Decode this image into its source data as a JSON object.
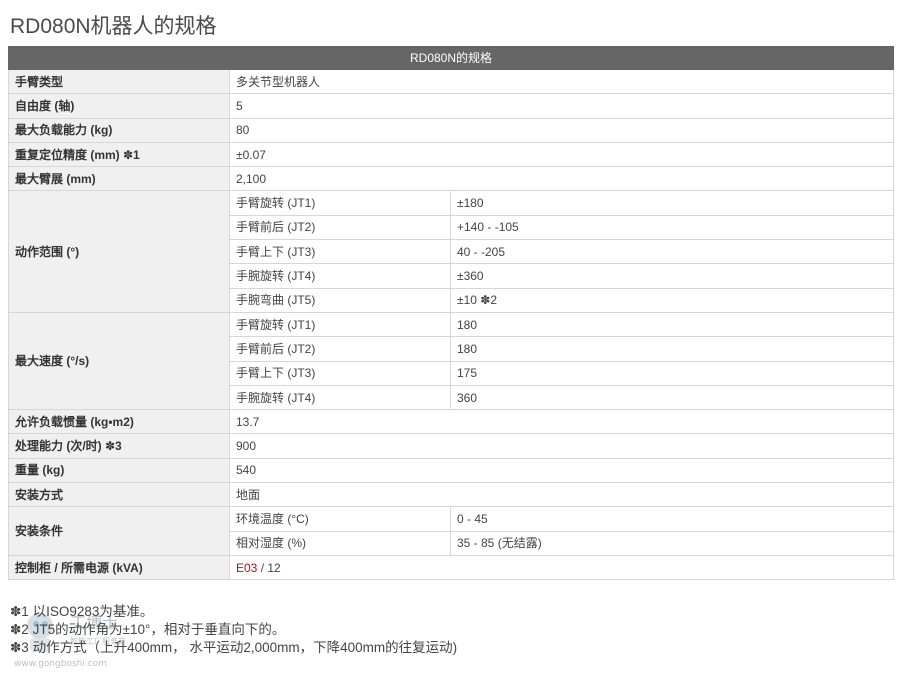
{
  "page_title": "RD080N机器人的规格",
  "table": {
    "header": "RD080N的规格",
    "rows": {
      "arm_type": {
        "label": "手臂类型",
        "value": "多关节型机器人"
      },
      "dof": {
        "label": "自由度 (轴)",
        "value": "5"
      },
      "payload": {
        "label": "最大负载能力 (kg)",
        "value": "80"
      },
      "repeatability": {
        "label": "重复定位精度 (mm) ✽1",
        "value": "±0.07"
      },
      "reach": {
        "label": "最大臂展 (mm)",
        "value": "2,100"
      },
      "motion_range": {
        "label": "动作范围 (°)",
        "items": [
          {
            "name": "手臂旋转 (JT1)",
            "value": "±180"
          },
          {
            "name": "手臂前后 (JT2)",
            "value": "+140 - -105"
          },
          {
            "name": "手臂上下 (JT3)",
            "value": "40 - -205"
          },
          {
            "name": "手腕旋转 (JT4)",
            "value": "±360"
          },
          {
            "name": "手腕弯曲 (JT5)",
            "value": "±10 ✽2"
          }
        ]
      },
      "max_speed": {
        "label": "最大速度 (°/s)",
        "items": [
          {
            "name": "手臂旋转 (JT1)",
            "value": "180"
          },
          {
            "name": "手臂前后 (JT2)",
            "value": "180"
          },
          {
            "name": "手臂上下 (JT3)",
            "value": "175"
          },
          {
            "name": "手腕旋转 (JT4)",
            "value": "360"
          }
        ]
      },
      "inertia": {
        "label": "允许负载惯量 (kg•m2)",
        "value": "13.7"
      },
      "throughput": {
        "label": "处理能力 (次/时) ✽3",
        "value": "900"
      },
      "weight": {
        "label": "重量 (kg)",
        "value": "540"
      },
      "mounting": {
        "label": "安装方式",
        "value": "地面"
      },
      "install_cond": {
        "label": "安装条件",
        "items": [
          {
            "name": "环境温度 (°C)",
            "value": "0 - 45"
          },
          {
            "name": "相对湿度 (%)",
            "value": "35 - 85 (无结露)"
          }
        ]
      },
      "controller": {
        "label": "控制柜 / 所需电源 (kVA)",
        "link": "E03",
        "suffix": " / 12"
      }
    }
  },
  "notes": [
    "✽1 以ISO9283为基准。",
    "✽2 JT5的动作角为±10°，相对于垂直向下的。",
    "✽3 动作方式（上升400mm， 水平运动2,000mm，下降400mm的往复运动)"
  ],
  "watermark": {
    "brand": "工博士",
    "sub": "智能工厂服务商",
    "url": "www.gongboshi.com"
  },
  "colors": {
    "header_bg": "#666666",
    "label_bg": "#f0f0f0",
    "link": "#d0021b"
  }
}
